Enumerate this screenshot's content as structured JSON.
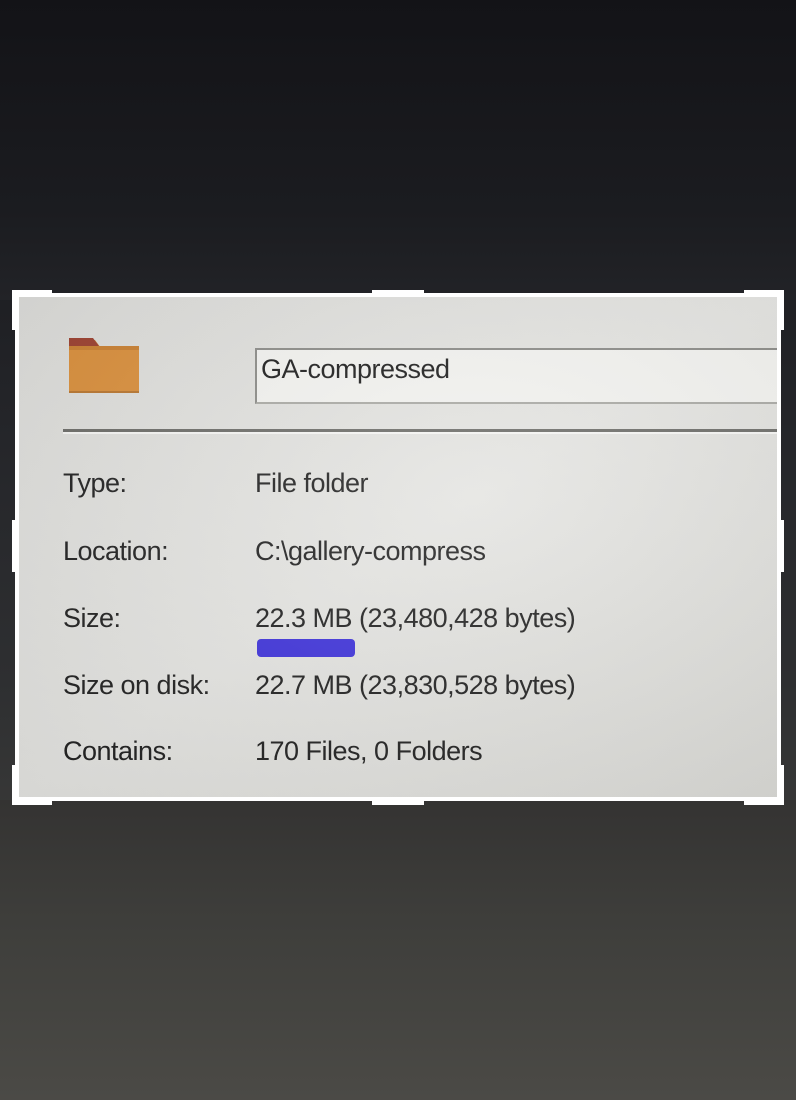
{
  "folder_name": "GA-compressed",
  "properties": {
    "type_label": "Type:",
    "type_value": "File folder",
    "location_label": "Location:",
    "location_value": "C:\\gallery-compress",
    "size_label": "Size:",
    "size_value": "22.3 MB (23,480,428 bytes)",
    "size_on_disk_label": "Size on disk:",
    "size_on_disk_value": "22.7 MB (23,830,528 bytes)",
    "contains_label": "Contains:",
    "contains_value": "170 Files, 0 Folders"
  },
  "icons": {
    "folder": "folder-icon"
  },
  "colors": {
    "folder": "#d98e3a",
    "folder_tab": "#9b3f2e",
    "highlight_mark": "#2f22d8",
    "crop_frame": "#ffffff"
  }
}
